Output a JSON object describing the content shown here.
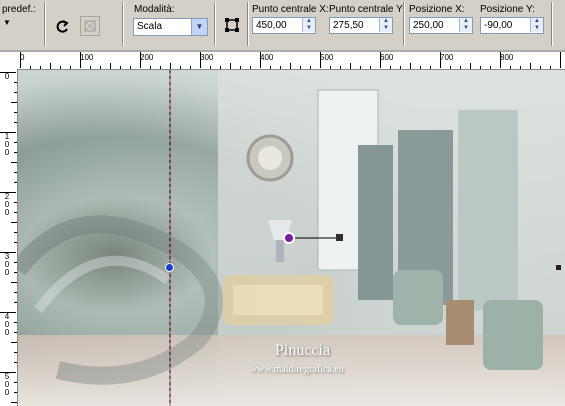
{
  "toolbar": {
    "preset_label": "predef.:",
    "mode_label": "Modalità:",
    "mode_value": "Scala",
    "center_x_label": "Punto centrale X:",
    "center_x_value": "450,00",
    "center_y_label": "Punto centrale Y:",
    "center_y_value": "275,50",
    "pos_x_label": "Posizione X:",
    "pos_x_value": "250,00",
    "pos_y_label": "Posizione Y:",
    "pos_y_value": "-90,00"
  },
  "ruler_h": [
    "0",
    "100",
    "200",
    "300",
    "400",
    "500",
    "600",
    "700",
    "800"
  ],
  "ruler_v": [
    "0",
    "100",
    "200",
    "300",
    "400",
    "500"
  ],
  "watermark": {
    "name": "Pinuccia",
    "url": "www.maidiregrafica.eu"
  },
  "colors": {
    "toolbar_bg": "#d4d0c8",
    "spin_border": "#7f9db9",
    "select_button": "#c3d3f5",
    "canvas_bg": "#ababab"
  }
}
